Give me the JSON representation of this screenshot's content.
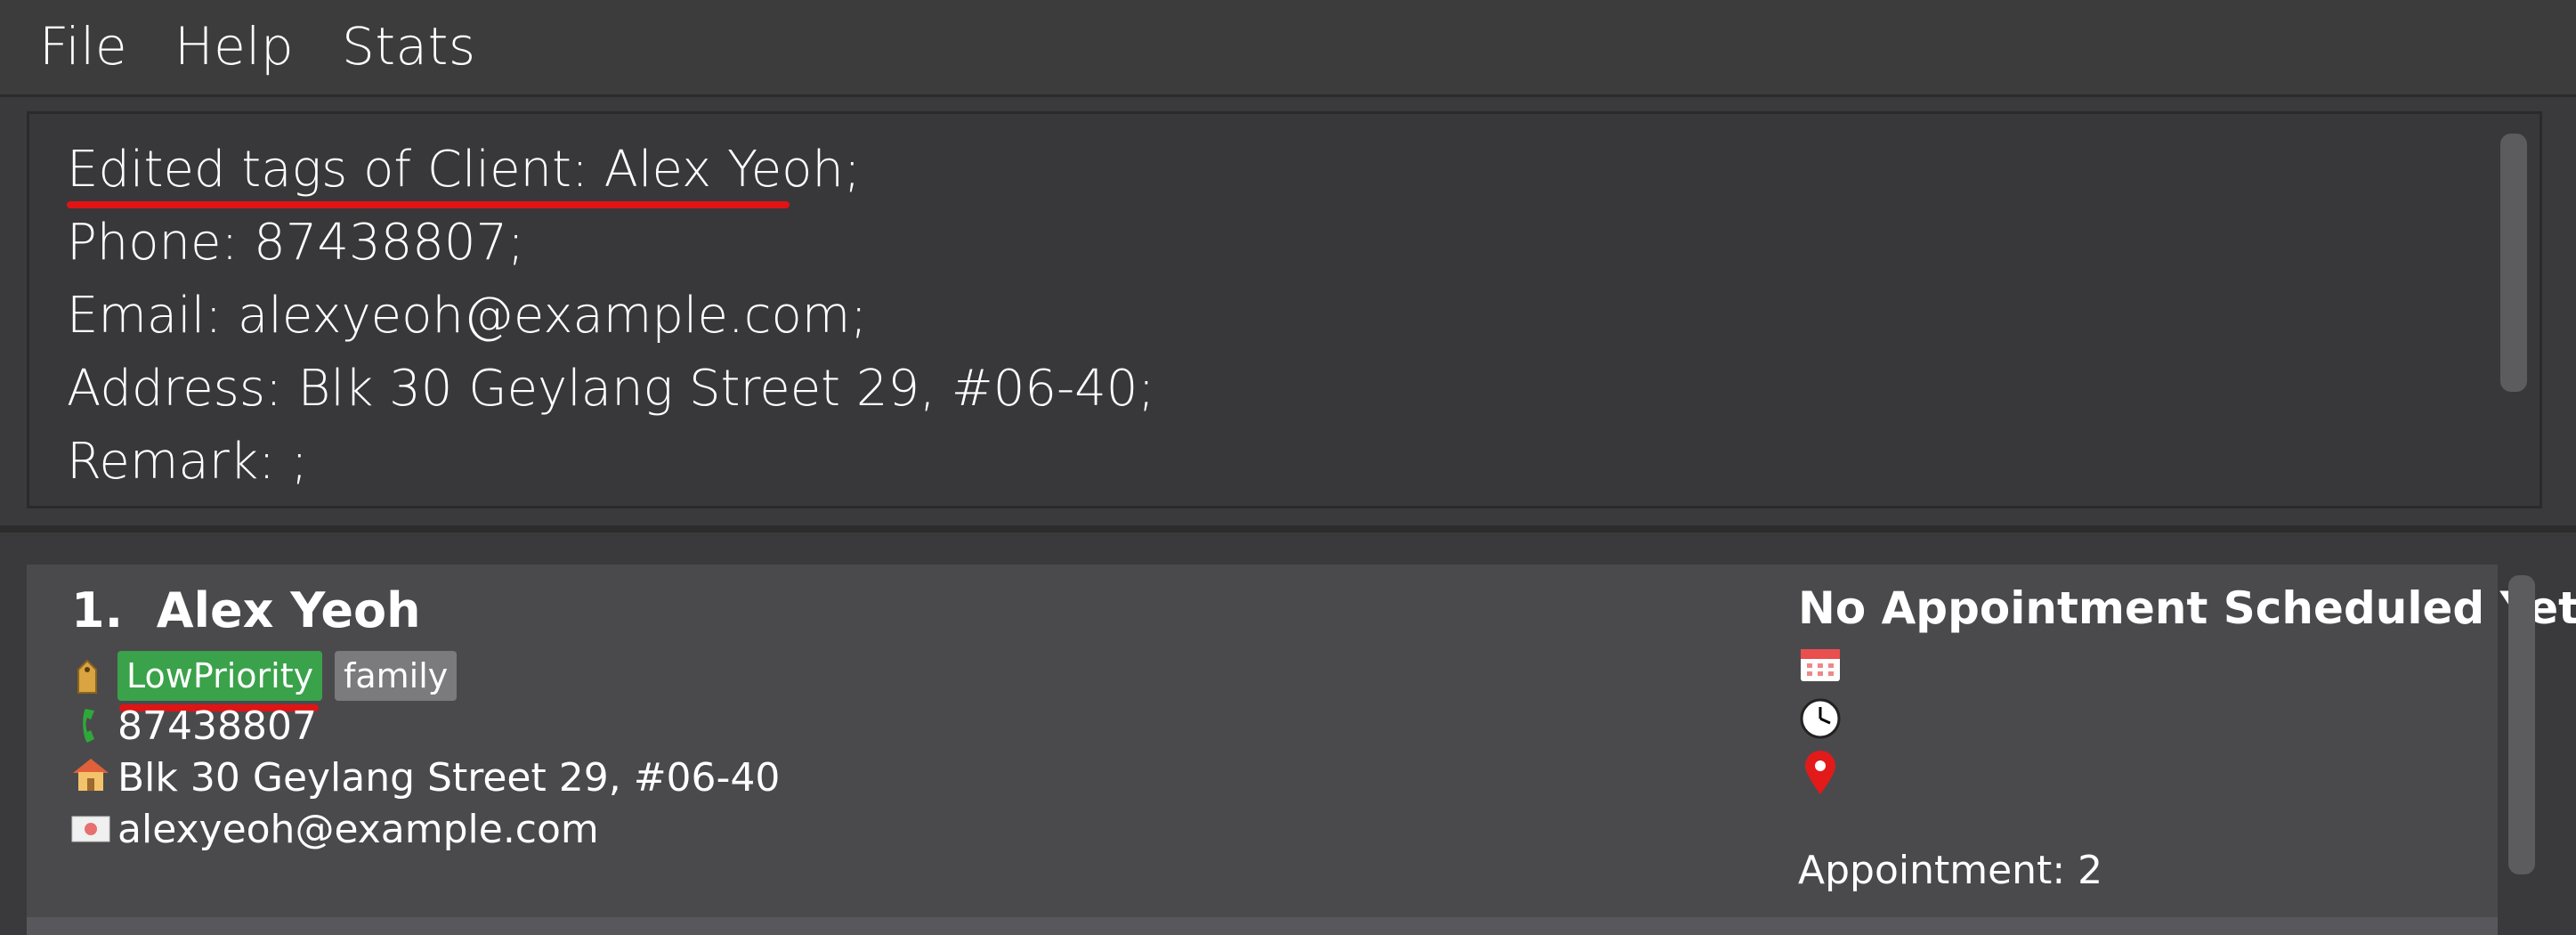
{
  "menu": {
    "file": "File",
    "help": "Help",
    "stats": "Stats"
  },
  "result": {
    "lines": [
      "Edited tags of Client: Alex Yeoh;",
      "Phone: 87438807;",
      "Email: alexyeoh@example.com;",
      "Address: Blk 30 Geylang Street 29, #06-40;",
      "Remark: ;"
    ]
  },
  "clients": [
    {
      "index": "1.",
      "name": "Alex Yeoh",
      "tags": [
        "LowPriority",
        "family"
      ],
      "phone": "87438807",
      "address": "Blk 30 Geylang Street 29, #06-40",
      "email": "alexyeoh@example.com",
      "appointment_status": "No Appointment Scheduled Yet",
      "appointment_count": "Appointment: 2"
    }
  ],
  "icons": {
    "tag": "tag-icon",
    "phone": "phone-icon",
    "address": "house-icon",
    "email": "envelope-icon",
    "date": "calendar-icon",
    "time": "clock-icon",
    "location": "location-pin-icon"
  },
  "colors": {
    "highlight_underline": "#e01414",
    "tag_low_priority": "#3aa24a",
    "tag_default": "#7b7b7e"
  }
}
